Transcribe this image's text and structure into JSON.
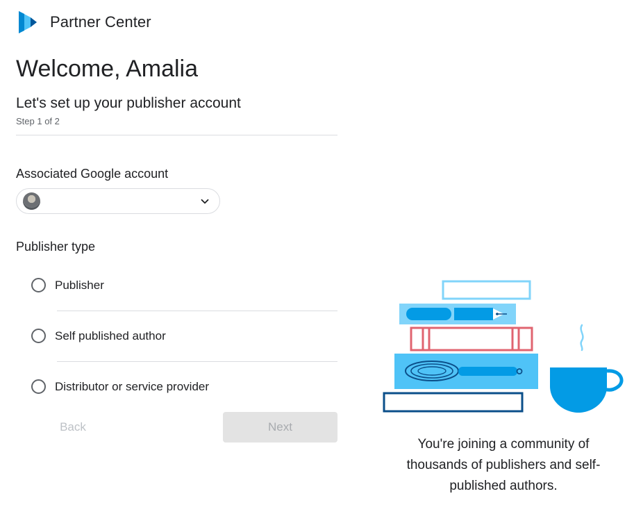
{
  "header": {
    "app_name": "Partner Center",
    "logo_icon": "play-books-logo-icon"
  },
  "welcome": {
    "title": "Welcome, Amalia",
    "subtitle": "Let's set up your publisher account",
    "step": "Step 1 of 2"
  },
  "account": {
    "label": "Associated Google account",
    "selected_value": "",
    "dropdown_icon": "chevron-down-icon"
  },
  "publisher_type": {
    "label": "Publisher type",
    "options": [
      {
        "label": "Publisher",
        "selected": false
      },
      {
        "label": "Self published author",
        "selected": false
      },
      {
        "label": "Distributor or service provider",
        "selected": false
      }
    ]
  },
  "actions": {
    "back_label": "Back",
    "next_label": "Next",
    "next_disabled": true
  },
  "community_text": "You're joining a community of thousands of publishers and self-published authors.",
  "colors": {
    "primary_blue": "#039be5",
    "light_blue": "#81d4fa",
    "mid_blue": "#4fc3f7",
    "dark_blue": "#0b4f8a",
    "book_red": "#e06470",
    "text": "#202124",
    "muted": "#5f6368",
    "divider": "#dadce0"
  }
}
